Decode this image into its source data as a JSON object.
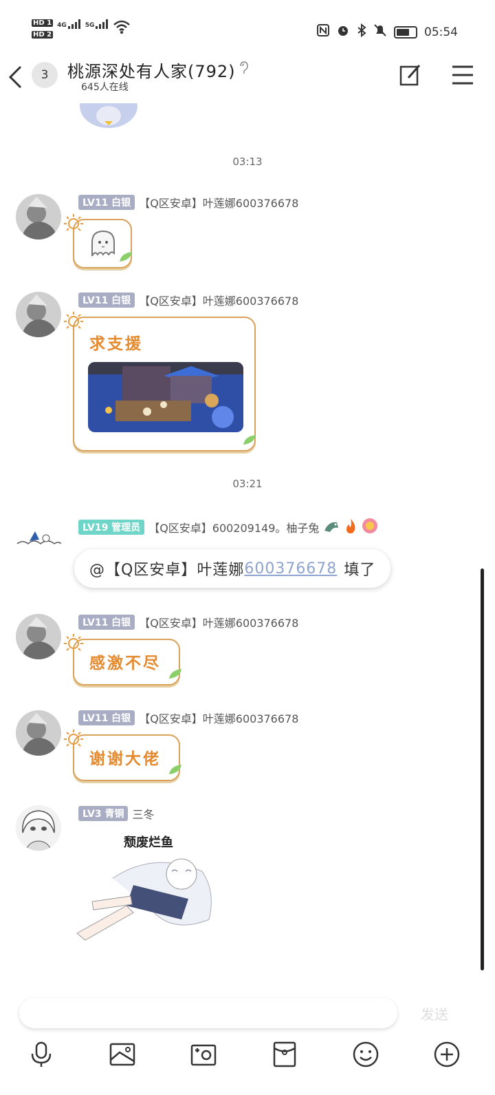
{
  "status_bar": {
    "hd1": "HD 1",
    "hd2": "HD 2",
    "sig1": "4G",
    "sig2": "5G",
    "time": "05:54"
  },
  "header": {
    "unread_count": "3",
    "title": "桃源深处有人家(792)",
    "online": "645人在线"
  },
  "timestamps": [
    "03:13",
    "03:21"
  ],
  "messages": [
    {
      "level": "LV11 白银",
      "name": "【Q区安卓】叶莲娜600376678",
      "type": "sticker",
      "icon": "ghost-icon"
    },
    {
      "level": "LV11 白银",
      "name": "【Q区安卓】叶莲娜600376678",
      "type": "text-image",
      "text": "求支援"
    },
    {
      "level": "LV19 管理员",
      "name": "【Q区安卓】600209149。柚子兔",
      "type": "mention",
      "mention_prefix": "@【Q区安卓】叶莲娜",
      "mention_id": "600376678",
      "mention_suffix": "填了"
    },
    {
      "level": "LV11 白银",
      "name": "【Q区安卓】叶莲娜600376678",
      "type": "text",
      "text": "感激不尽"
    },
    {
      "level": "LV11 白银",
      "name": "【Q区安卓】叶莲娜600376678",
      "type": "text",
      "text": "谢谢大佬"
    },
    {
      "level": "LV3 青铜",
      "name": "三冬",
      "type": "sticker",
      "caption": "颓废烂鱼"
    }
  ],
  "input": {
    "placeholder": "",
    "send_label": "发送"
  },
  "toolbar_icons": [
    "microphone-icon",
    "image-icon",
    "camera-icon",
    "red-packet-icon",
    "emoji-icon",
    "plus-icon"
  ],
  "colors": {
    "bubble_border": "#d9a15a",
    "bubble_text": "#e58a2e",
    "level_badge": "#a9adc4",
    "admin_badge": "#6fd5c8",
    "mention_link": "#8ea3cf"
  }
}
